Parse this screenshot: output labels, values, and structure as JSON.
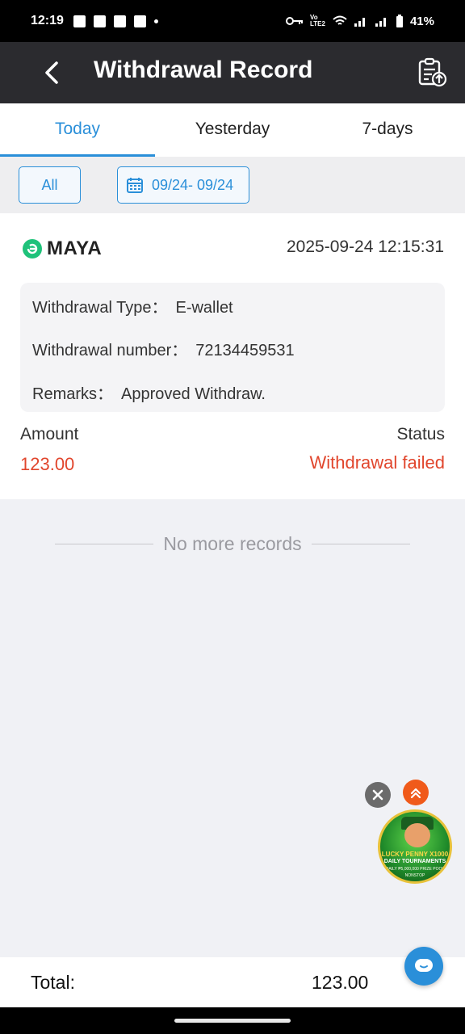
{
  "status_bar": {
    "time": "12:19",
    "battery": "41%",
    "network_label": "Vo LTE2"
  },
  "header": {
    "title": "Withdrawal Record",
    "back_icon": "chevron-left-icon",
    "records_icon": "clipboard-upload-icon"
  },
  "tabs": [
    {
      "label": "Today",
      "active": true
    },
    {
      "label": "Yesterday",
      "active": false
    },
    {
      "label": "7-days",
      "active": false
    }
  ],
  "filters": {
    "all_label": "All",
    "date_range": "09/24- 09/24"
  },
  "record": {
    "provider": "MAYA",
    "datetime": "2025-09-24 12:15:31",
    "type_key": "Withdrawal Type：",
    "type_value": "E-wallet",
    "number_key": "Withdrawal number：",
    "number_value": "72134459531",
    "remarks_key": "Remarks：",
    "remarks_value": "Approved Withdraw.",
    "amount_label": "Amount",
    "amount_value": "123.00",
    "status_label": "Status",
    "status_value": "Withdrawal failed"
  },
  "list_end": "No more records",
  "promo": {
    "line1": "LUCKY PENNY X1000",
    "line2": "DAILY TOURNAMENTS",
    "line3": "DAILY ₱5,000,000 PRIZE POOL",
    "line4": "NONSTOP"
  },
  "footer": {
    "total_label": "Total:",
    "total_value": "123.00"
  },
  "colors": {
    "accent": "#2a8fd9",
    "error": "#e1462d",
    "header_bg": "#2b2b2f",
    "maya_green": "#1fc27a"
  }
}
